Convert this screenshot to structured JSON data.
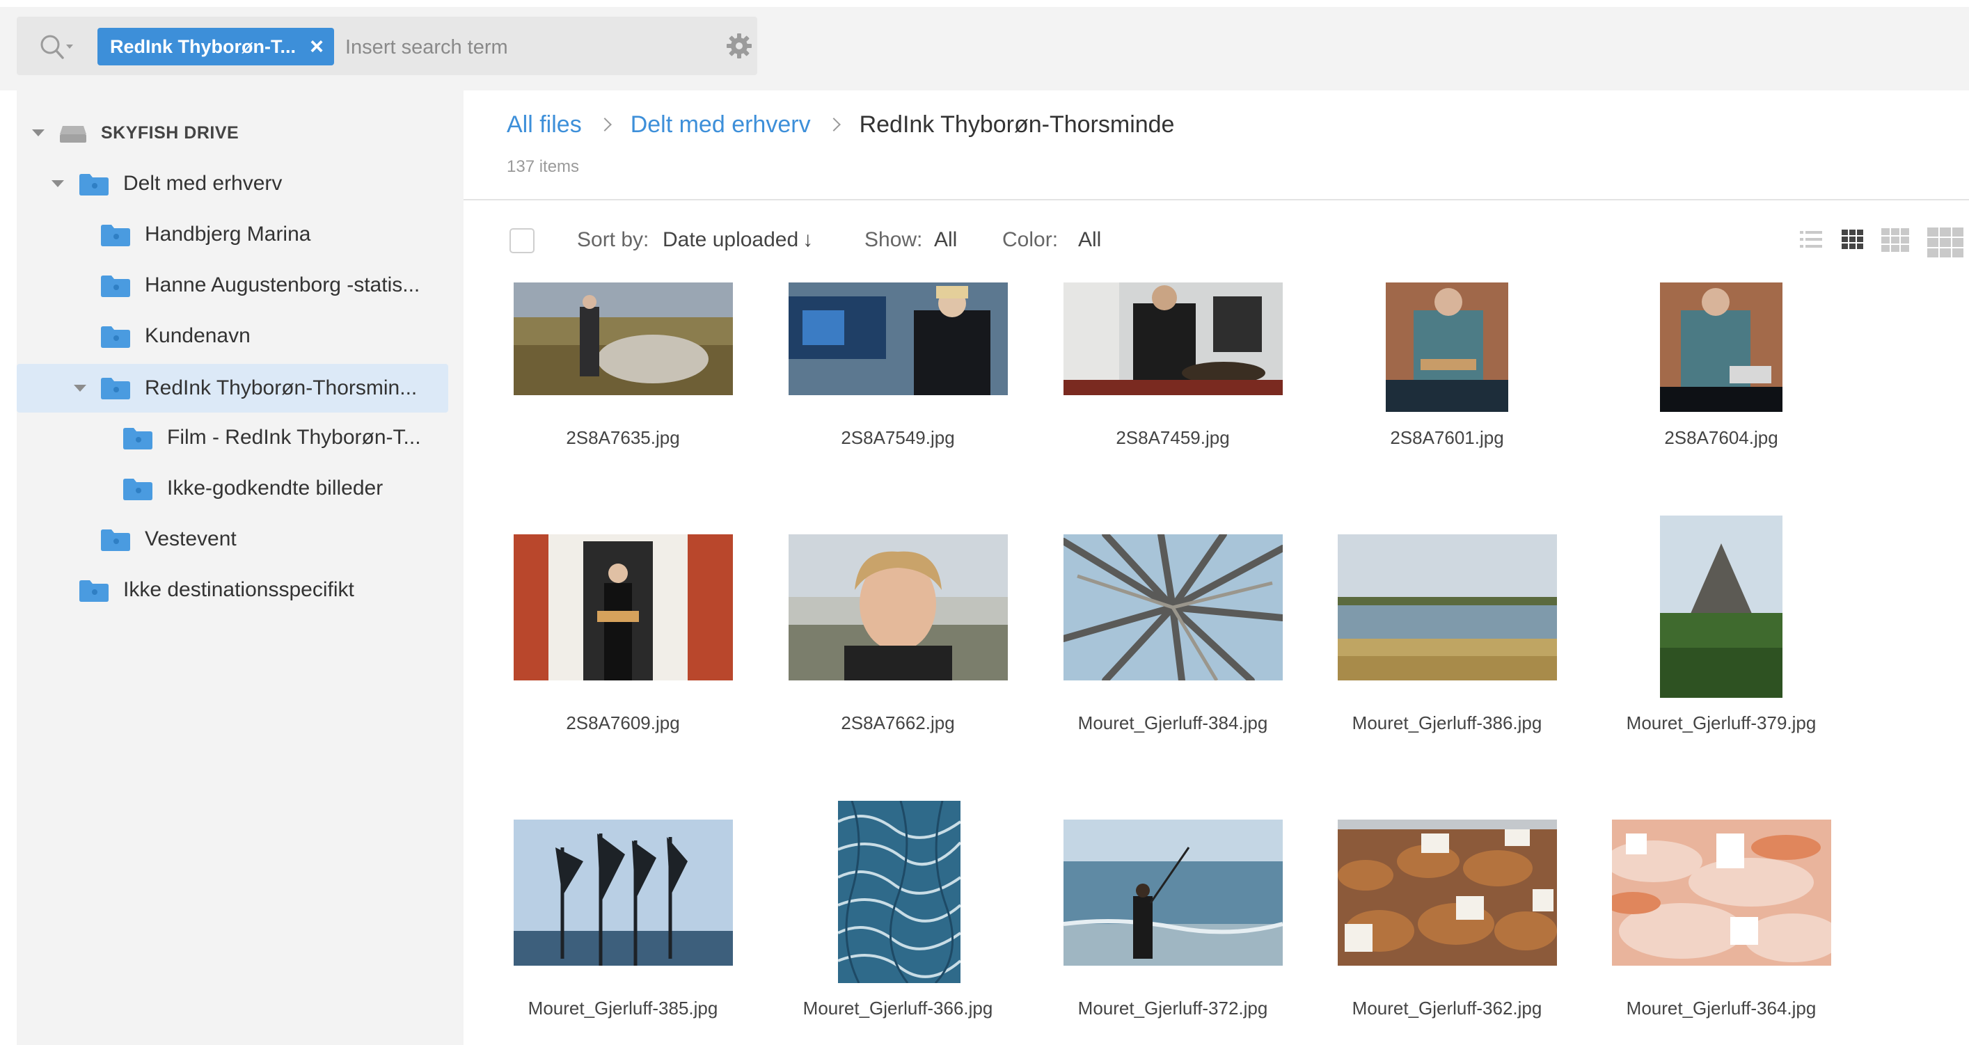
{
  "search": {
    "filter_chip": "RedInk Thyborøn-T...",
    "filter_close": "×",
    "placeholder": "Insert search term"
  },
  "sidebar": {
    "drive_label": "SKYFISH DRIVE",
    "items": [
      {
        "label": "Delt med erhverv"
      },
      {
        "label": "Handbjerg Marina"
      },
      {
        "label": "Hanne Augustenborg -statis..."
      },
      {
        "label": "Kundenavn"
      },
      {
        "label": "RedInk Thyborøn-Thorsmin..."
      },
      {
        "label": "Film - RedInk Thyborøn-T..."
      },
      {
        "label": "Ikke-godkendte billeder"
      },
      {
        "label": "Vestevent"
      },
      {
        "label": "Ikke destinationsspecifikt"
      }
    ]
  },
  "breadcrumb": {
    "root": "All files",
    "parent": "Delt med erhverv",
    "current": "RedInk Thyborøn-Thorsminde"
  },
  "item_count": "137 items",
  "toolbar": {
    "sort_label": "Sort by:",
    "sort_value": "Date uploaded",
    "sort_arrow": "↓",
    "show_label": "Show:",
    "show_value": "All",
    "color_label": "Color:",
    "color_value": "All"
  },
  "files": [
    {
      "name": "2S8A7635.jpg"
    },
    {
      "name": "2S8A7549.jpg"
    },
    {
      "name": "2S8A7459.jpg"
    },
    {
      "name": "2S8A7601.jpg"
    },
    {
      "name": "2S8A7604.jpg"
    },
    {
      "name": "2S8A7609.jpg"
    },
    {
      "name": "2S8A7662.jpg"
    },
    {
      "name": "Mouret_Gjerluff-384.jpg"
    },
    {
      "name": "Mouret_Gjerluff-386.jpg"
    },
    {
      "name": "Mouret_Gjerluff-379.jpg"
    },
    {
      "name": "Mouret_Gjerluff-385.jpg"
    },
    {
      "name": "Mouret_Gjerluff-366.jpg"
    },
    {
      "name": "Mouret_Gjerluff-372.jpg"
    },
    {
      "name": "Mouret_Gjerluff-362.jpg"
    },
    {
      "name": "Mouret_Gjerluff-364.jpg"
    }
  ],
  "colors": {
    "accent": "#3d8fd9",
    "folder": "#4a9be0",
    "selected_row": "#dce9f7",
    "panel_bg": "#f3f3f3"
  }
}
